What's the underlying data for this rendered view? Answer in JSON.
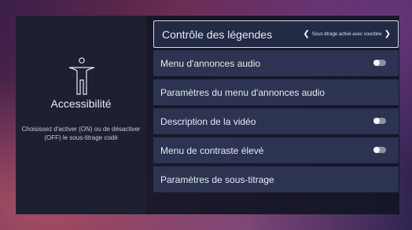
{
  "left_panel": {
    "icon": "accessibility-person-icon",
    "title": "Accessibilité",
    "description": "Choisissez d'activer (ON) ou de désactiver (OFF) le sous-titrage codé"
  },
  "menu": {
    "items": [
      {
        "label": "Contrôle des légendes",
        "value": "Sous-titrage activé avec sourdine",
        "focused": true
      },
      {
        "label": "Menu d'annonces audio",
        "toggle": "off"
      },
      {
        "label": "Paramètres du menu d'annonces audio"
      },
      {
        "label": "Description de la vidéo",
        "toggle": "off"
      },
      {
        "label": "Menu de contraste élevé",
        "toggle": "off"
      },
      {
        "label": "Paramètres de sous-titrage"
      }
    ]
  },
  "colors": {
    "panel": "#12162a",
    "row": "#2c3451",
    "focused_border": "#d7dbe6",
    "toggle_off": "#8a90a2"
  }
}
